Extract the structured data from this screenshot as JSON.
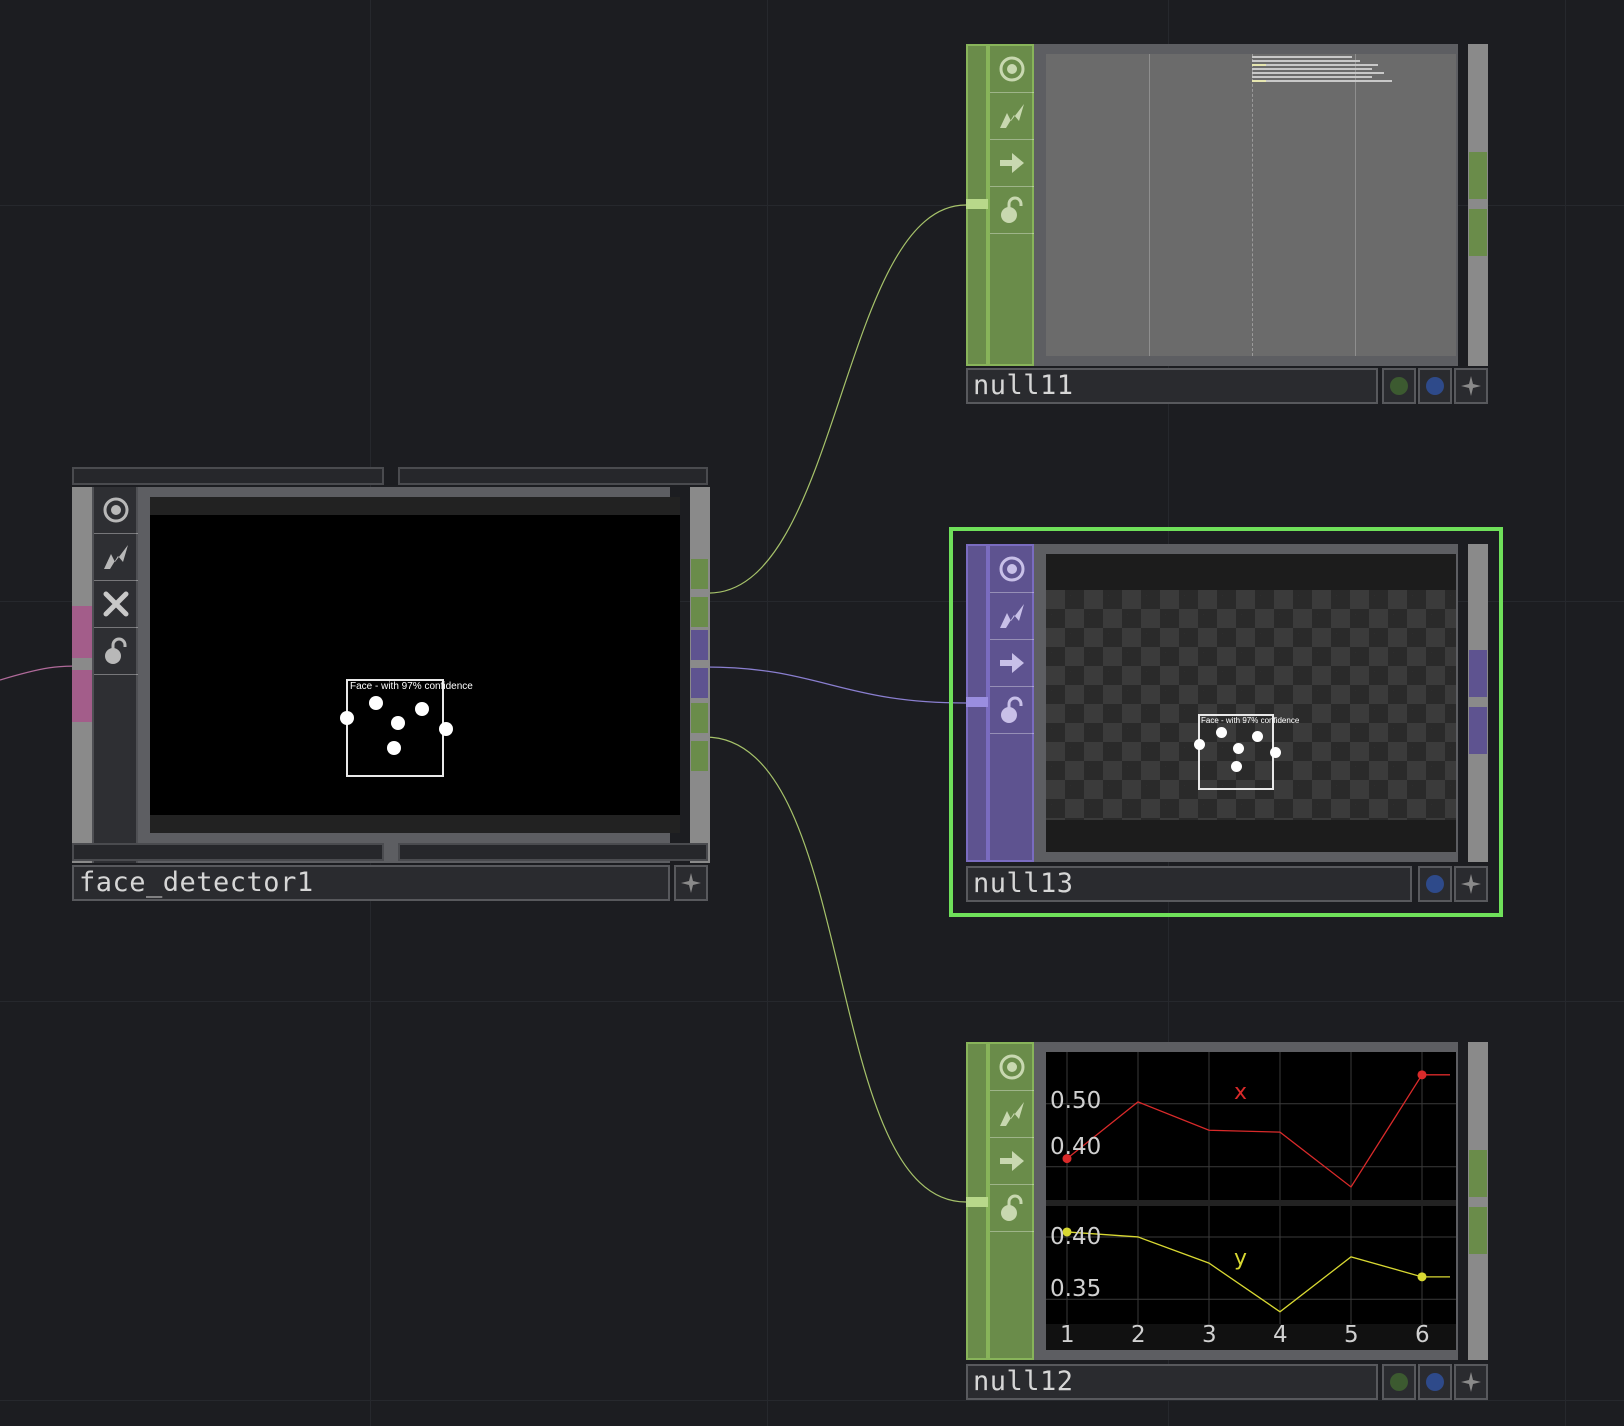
{
  "colors": {
    "background": "#1c1d21",
    "top_green": "#6a8c4a",
    "sop_purple": "#5e5390",
    "chop_wire": "#a6c26a",
    "top_wire": "#8a7fd0",
    "selection": "#6fe05a",
    "series_x": "#d92a2a",
    "series_y": "#d8d832"
  },
  "nodes": {
    "face_detector": {
      "name": "face_detector1",
      "face_label": "Face - with 97% confidence",
      "icons": [
        "viewer-icon",
        "cook-icon",
        "bypass-x-icon",
        "lock-icon"
      ]
    },
    "null11": {
      "name": "null11",
      "icons": [
        "viewer-icon",
        "cook-icon",
        "export-arrow-icon",
        "lock-icon"
      ]
    },
    "null13": {
      "name": "null13",
      "face_label": "Face - with 97% confidence",
      "icons": [
        "viewer-icon",
        "cook-icon",
        "export-arrow-icon",
        "lock-icon"
      ]
    },
    "null12": {
      "name": "null12",
      "icons": [
        "viewer-icon",
        "cook-icon",
        "export-arrow-icon",
        "lock-icon"
      ]
    }
  },
  "chart_data": {
    "type": "line",
    "x": [
      1,
      2,
      3,
      4,
      5,
      6
    ],
    "x_ticks": [
      "1",
      "2",
      "3",
      "4",
      "5",
      "6"
    ],
    "series": [
      {
        "name": "x",
        "values": [
          0.413,
          0.503,
          0.458,
          0.455,
          0.368,
          0.546
        ],
        "y_ticks": [
          "0.50",
          "0.40"
        ],
        "ylim": [
          0.36,
          0.56
        ],
        "color": "#d92a2a"
      },
      {
        "name": "y",
        "values": [
          0.404,
          0.4,
          0.379,
          0.34,
          0.384,
          0.368
        ],
        "y_ticks": [
          "0.40",
          "0.35"
        ],
        "ylim": [
          0.335,
          0.42
        ],
        "color": "#d8d832"
      }
    ],
    "grid": true
  }
}
